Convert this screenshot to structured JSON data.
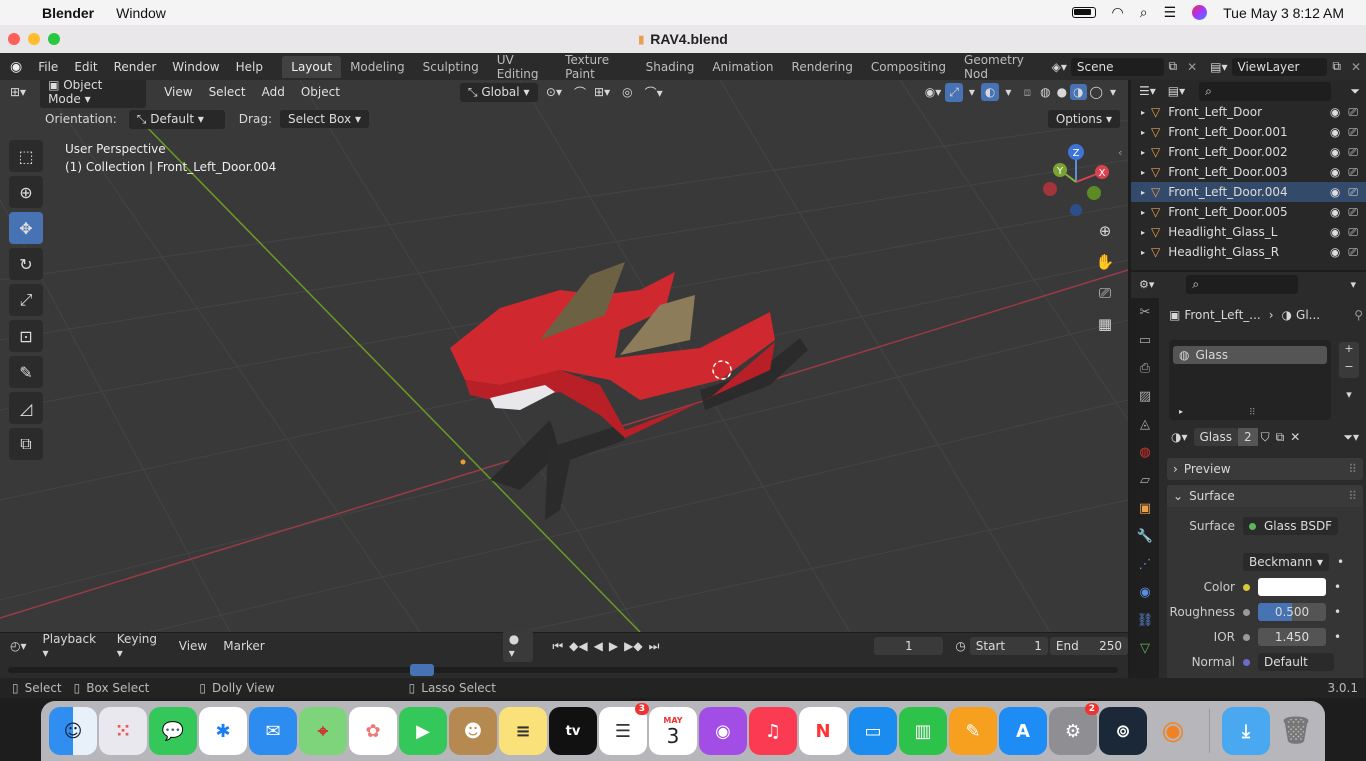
{
  "mac": {
    "apple": "",
    "app_name": "Blender",
    "menu_window": "Window",
    "clock": "Tue May 3  8:12 AM"
  },
  "window": {
    "title": "RAV4.blend"
  },
  "topbar": {
    "menus": [
      "File",
      "Edit",
      "Render",
      "Window",
      "Help"
    ],
    "workspaces": [
      "Layout",
      "Modeling",
      "Sculpting",
      "UV Editing",
      "Texture Paint",
      "Shading",
      "Animation",
      "Rendering",
      "Compositing",
      "Geometry Nod"
    ],
    "scene": "Scene",
    "view_layer": "ViewLayer"
  },
  "viewport": {
    "mode": "Object Mode",
    "menus": [
      "View",
      "Select",
      "Add",
      "Object"
    ],
    "transform": "Global",
    "orientation_label": "Orientation:",
    "orientation_value": "Default",
    "drag_label": "Drag:",
    "drag_value": "Select Box",
    "options": "Options",
    "perspective": "User Perspective",
    "collection_info": "(1) Collection | Front_Left_Door.004",
    "gizmo": {
      "z": "Z",
      "y": "Y",
      "x": "X"
    }
  },
  "outliner": {
    "items": [
      "Front_Left_Door",
      "Front_Left_Door.001",
      "Front_Left_Door.002",
      "Front_Left_Door.003",
      "Front_Left_Door.004",
      "Front_Left_Door.005",
      "Headlight_Glass_L",
      "Headlight_Glass_R"
    ],
    "selected_index": 4
  },
  "properties": {
    "breadcrumb_object": "Front_Left_...",
    "breadcrumb_material": "Gl...",
    "slot": "Glass",
    "material_name": "Glass",
    "users": "2",
    "panel_preview": "Preview",
    "panel_surface": "Surface",
    "surface_label": "Surface",
    "surface_value": "Glass BSDF",
    "distribution": "Beckmann",
    "color_label": "Color",
    "color_value": "#ffffff",
    "roughness_label": "Roughness",
    "roughness_value": "0.500",
    "roughness_fraction": 0.5,
    "ior_label": "IOR",
    "ior_value": "1.450",
    "normal_label": "Normal",
    "normal_value": "Default"
  },
  "timeline": {
    "menus": [
      "Playback",
      "Keying",
      "View",
      "Marker"
    ],
    "current_frame": "1",
    "start_label": "Start",
    "start_value": "1",
    "end_label": "End",
    "end_value": "250"
  },
  "status": {
    "select": "Select",
    "box_select": "Box Select",
    "dolly": "Dolly View",
    "lasso": "Lasso Select",
    "version": "3.0.1"
  },
  "dock": {
    "reminders_badge": "3",
    "calendar_month": "MAY",
    "calendar_day": "3",
    "settings_badge": "2"
  }
}
